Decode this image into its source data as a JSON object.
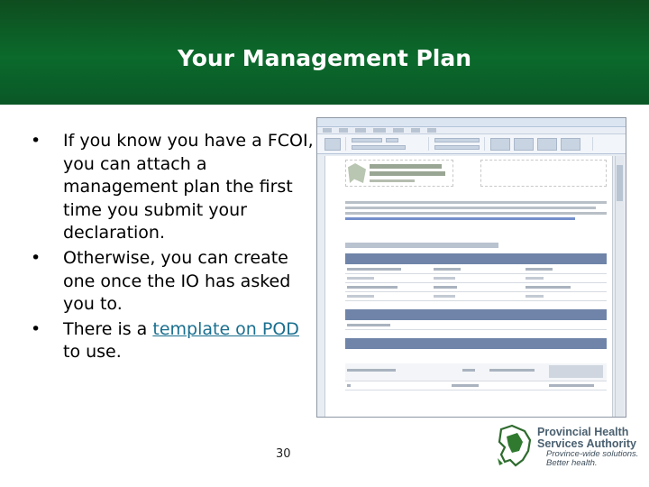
{
  "slide": {
    "title": "Your Management Plan",
    "page_number": "30"
  },
  "bullets": [
    {
      "text": "If you know you have a FCOI, you can attach a management plan the first time you submit your declaration."
    },
    {
      "text": "Otherwise, you can create one once the IO has asked you to."
    },
    {
      "before": "There is a ",
      "link": "template on POD",
      "after": " to use."
    }
  ],
  "logo": {
    "line1": "Provincial Health",
    "line2": "Services Authority",
    "line3": "Province-wide solutions.",
    "line4": "Better health."
  },
  "colors": {
    "title_bar": "#0b6a2c",
    "link": "#1a6f8f",
    "table_band": "#6f84a8"
  }
}
